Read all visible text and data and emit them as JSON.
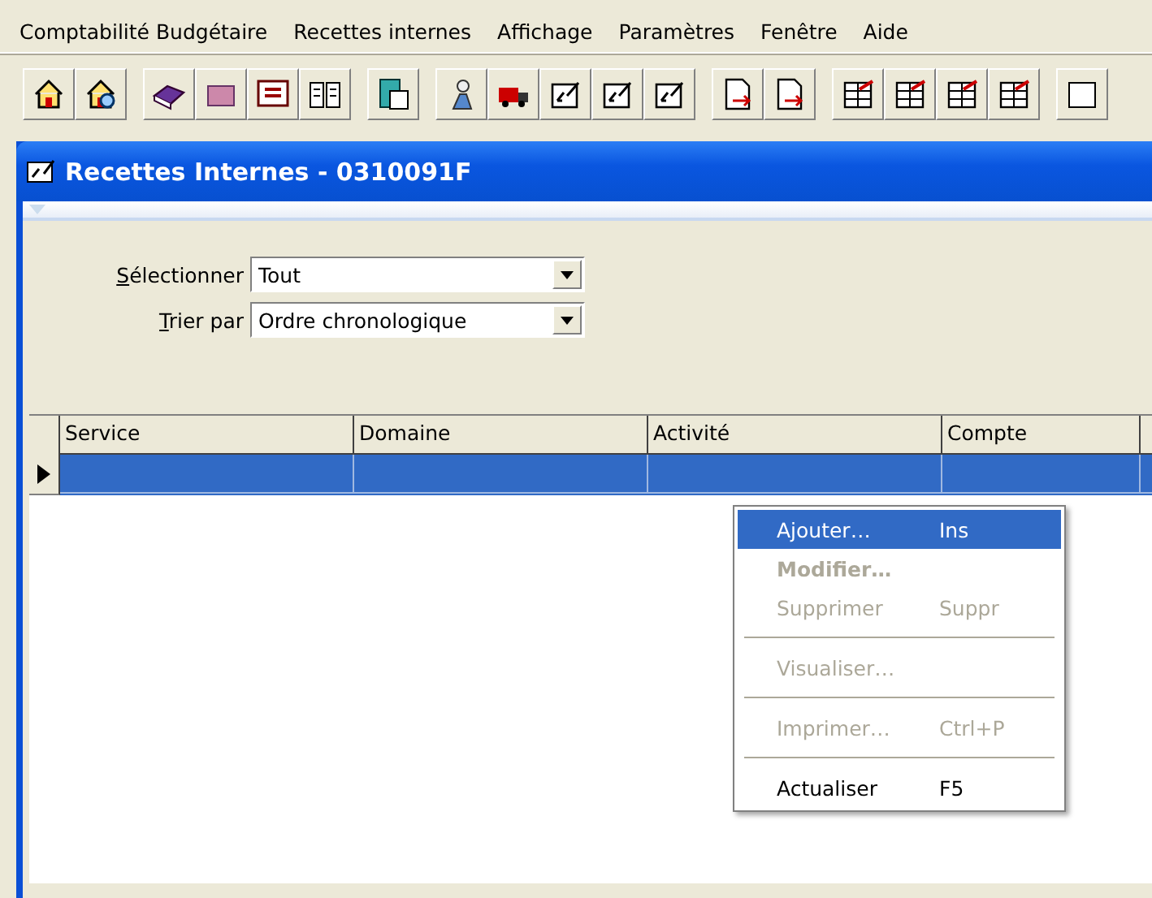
{
  "menu_bar": [
    "Comptabilité Budgétaire",
    "Recettes internes",
    "Affichage",
    "Paramètres",
    "Fenêtre",
    "Aide"
  ],
  "window": {
    "title": "Recettes Internes - 0310091F"
  },
  "filters": [
    {
      "label": "Sélectionner",
      "value": "Tout"
    },
    {
      "label": "Trier par",
      "value": "Ordre chronologique"
    }
  ],
  "table": {
    "columns": [
      "Service",
      "Domaine",
      "Activité",
      "Compte"
    ],
    "rows": [
      {
        "selected": true
      }
    ]
  },
  "context_menu": [
    {
      "kind": "item",
      "label": "Ajouter…",
      "shortcut": "Ins",
      "selected": true,
      "disabled": false,
      "bold": false
    },
    {
      "kind": "item",
      "label": "Modifier…",
      "selected": false,
      "disabled": true,
      "bold": true
    },
    {
      "kind": "item",
      "label": "Supprimer",
      "shortcut": "Suppr",
      "selected": false,
      "disabled": true,
      "bold": false
    },
    {
      "kind": "separator"
    },
    {
      "kind": "item",
      "label": "Visualiser…",
      "selected": false,
      "disabled": true,
      "bold": false
    },
    {
      "kind": "separator"
    },
    {
      "kind": "item",
      "label": "Imprimer…",
      "shortcut": "Ctrl+P",
      "selected": false,
      "disabled": true,
      "bold": false
    },
    {
      "kind": "separator"
    },
    {
      "kind": "item",
      "label": "Actualiser",
      "shortcut": "F5",
      "selected": false,
      "disabled": false,
      "bold": false
    }
  ]
}
